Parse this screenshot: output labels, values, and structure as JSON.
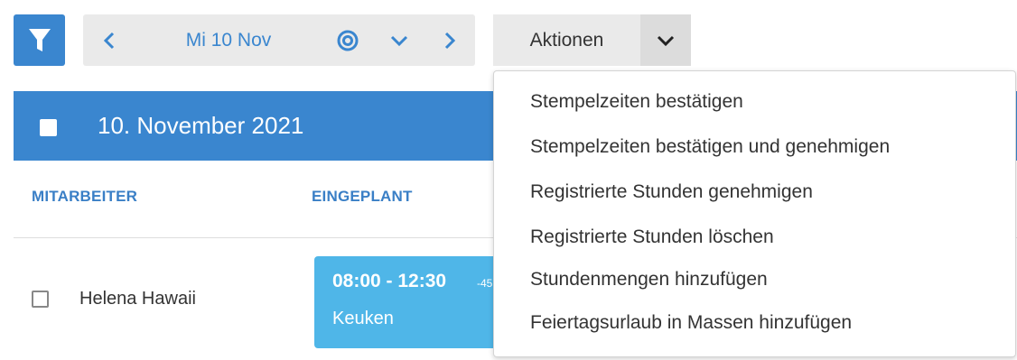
{
  "toolbar": {
    "date_label": "Mi 10 Nov",
    "actions_label": "Aktionen"
  },
  "day": {
    "title": "10. November 2021"
  },
  "columns": [
    "MITARBEITER",
    "EINGEPLANT"
  ],
  "rows": [
    {
      "employee": "Helena Hawaii",
      "shift_time": "08:00 - 12:30",
      "shift_extra": "-45",
      "shift_place": "Keuken"
    }
  ],
  "actions_menu": [
    "Stempelzeiten bestätigen",
    "Stempelzeiten bestätigen und genehmigen",
    "Registrierte Stunden genehmigen",
    "Registrierte Stunden löschen",
    "Stundenmengen hinzufügen",
    "Feiertagsurlaub in Massen hinzufügen"
  ],
  "icons": {
    "filter": "filter-icon",
    "prev": "chevron-left-icon",
    "today": "target-icon",
    "down": "chevron-down-icon",
    "next": "chevron-right-icon",
    "actions_caret": "chevron-down-icon"
  },
  "colors": {
    "accent": "#3a86cf",
    "shift": "#4fb6e8",
    "button_bg": "#eaeaea"
  }
}
